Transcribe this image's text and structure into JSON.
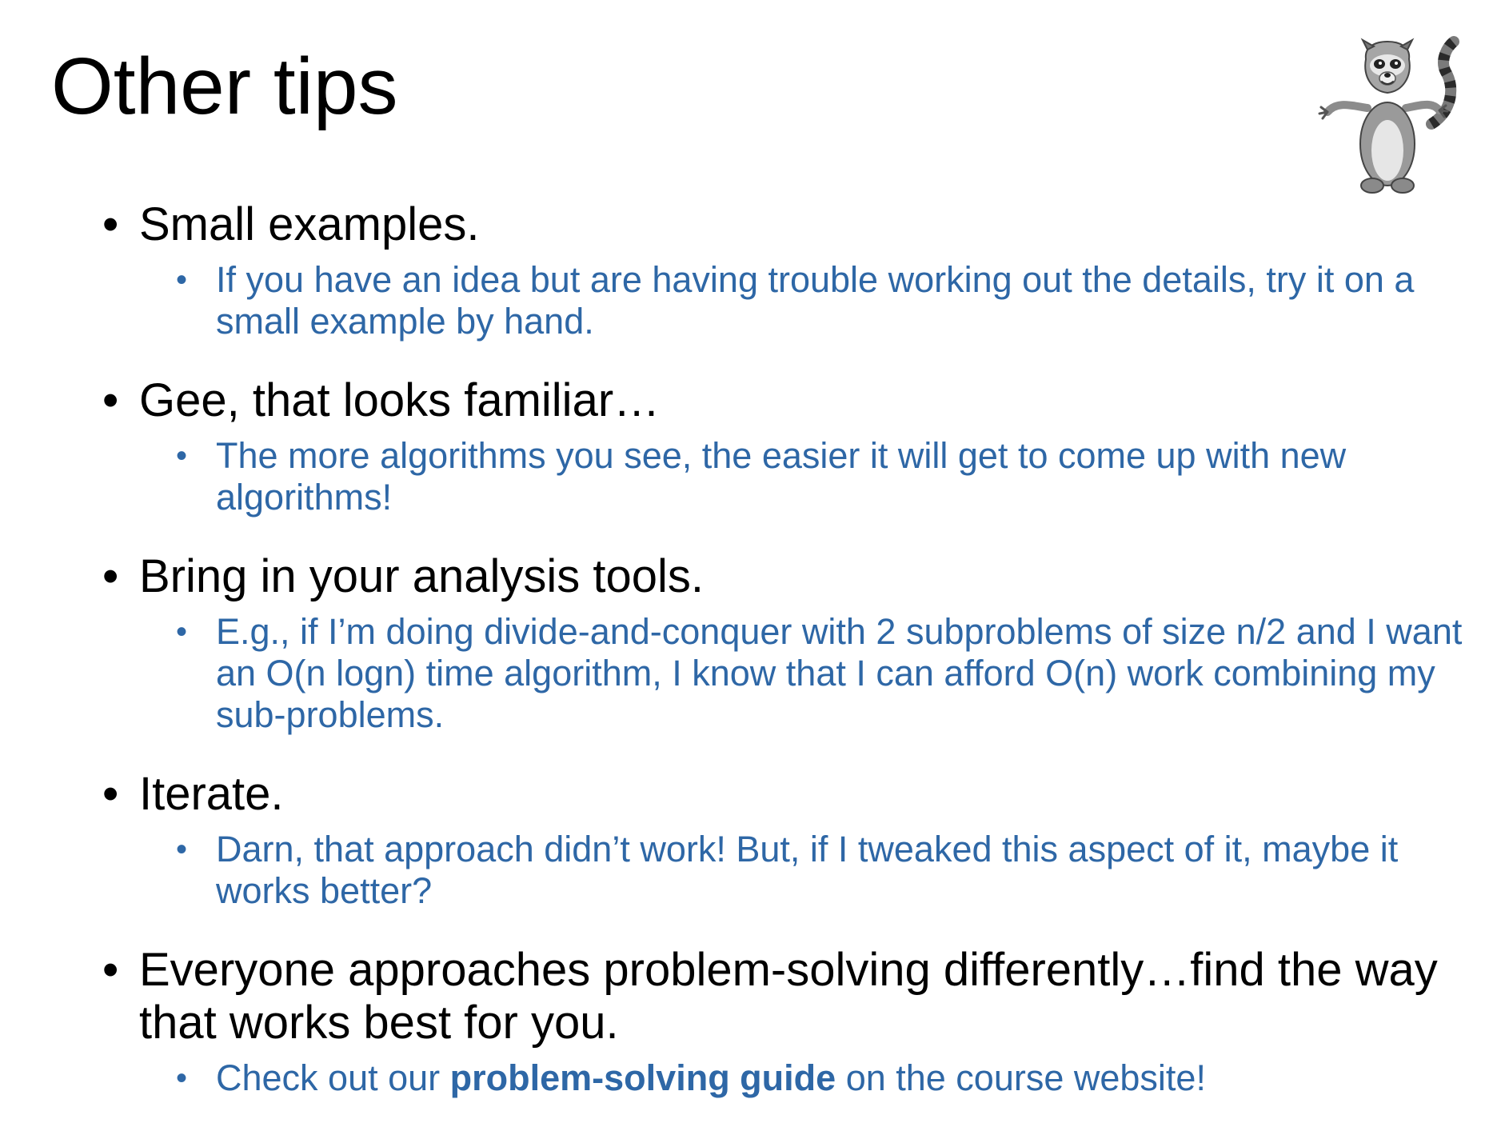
{
  "slide": {
    "title": "Other tips",
    "mascot_icon": "lemur-mascot-icon",
    "colors": {
      "title": "#000000",
      "level1_text": "#000000",
      "level2_text": "#2e67a6"
    },
    "items": [
      {
        "heading": "Small examples.",
        "sub": "If you have an idea but are having trouble working out the details, try it on a small example by hand."
      },
      {
        "heading": "Gee, that looks familiar…",
        "sub": "The more algorithms you see, the easier it will get to come up with new algorithms!"
      },
      {
        "heading": "Bring in your analysis tools.",
        "sub": "E.g., if I’m doing divide-and-conquer with 2 subproblems of size n/2 and I want an O(n logn) time algorithm, I know that I can afford O(n) work combining my sub-problems."
      },
      {
        "heading": "Iterate.",
        "sub": "Darn, that approach didn’t work!  But, if I tweaked this aspect of it, maybe it works better?"
      },
      {
        "heading": "Everyone approaches problem-solving differently…find the way that works best for you.",
        "sub_prefix": "Check out our ",
        "sub_bold": "problem-solving guide",
        "sub_suffix": " on the course website!"
      }
    ],
    "bullet_char": "•"
  }
}
